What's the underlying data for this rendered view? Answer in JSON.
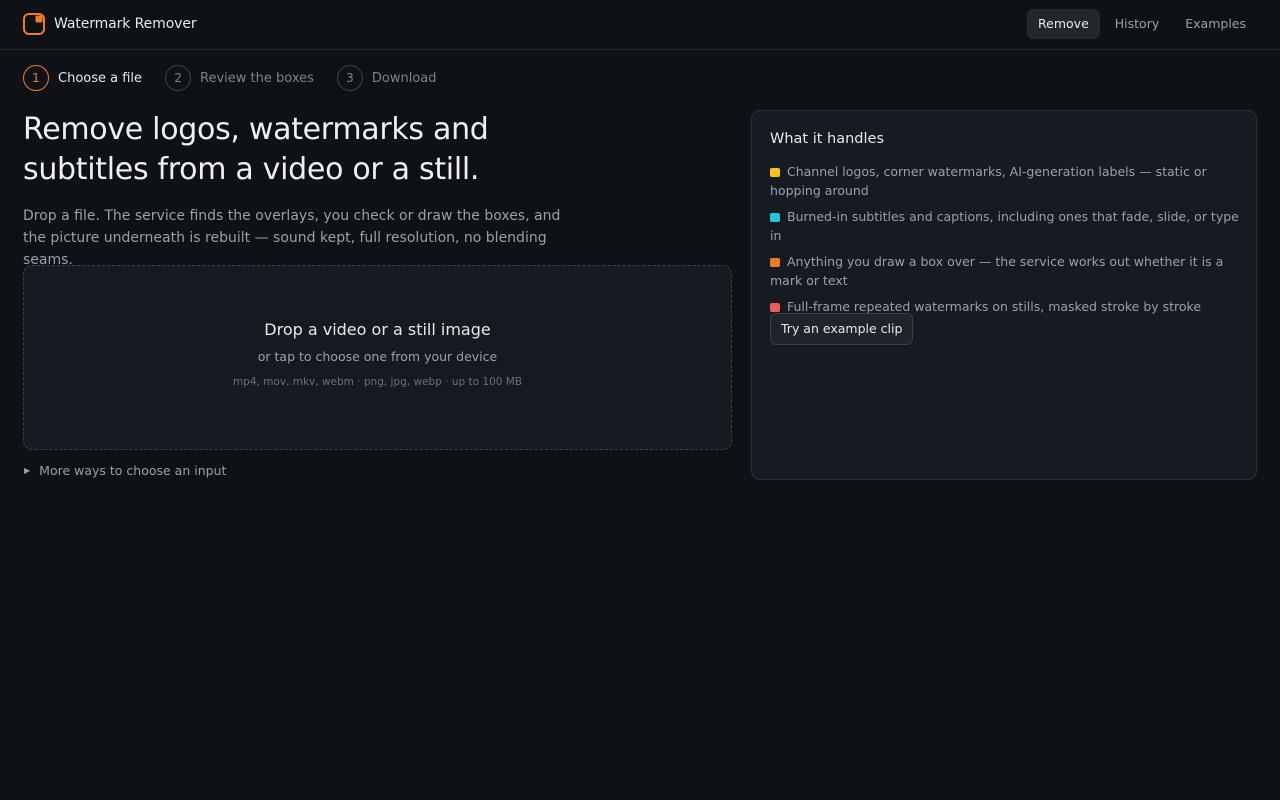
{
  "app": {
    "title": "Watermark Remover"
  },
  "nav": {
    "items": [
      {
        "label": "Remove",
        "active": true
      },
      {
        "label": "History",
        "active": false
      },
      {
        "label": "Examples",
        "active": false
      }
    ]
  },
  "steps": [
    {
      "number": "1",
      "label": "Choose a file",
      "active": true
    },
    {
      "number": "2",
      "label": "Review the boxes",
      "active": false
    },
    {
      "number": "3",
      "label": "Download",
      "active": false
    }
  ],
  "hero": {
    "headline": "Remove logos, watermarks and subtitles from a video or a still.",
    "lede": "Drop a file. The service finds the overlays, you check or draw the boxes, and the picture underneath is rebuilt — sound kept, full resolution, no blending seams."
  },
  "dropzone": {
    "title": "Drop a video or a still image",
    "subtitle": "or tap to choose one from your device",
    "formats": "mp4, mov, mkv, webm · png, jpg, webp · up to 100 MB"
  },
  "more_ways": {
    "label": "More ways to choose an input",
    "icon": "disclosure-triangle-icon"
  },
  "handles": {
    "title": "What it handles",
    "items": [
      {
        "text": "Channel logos, corner watermarks, AI-generation labels — static or hopping around",
        "color": "#f5c518"
      },
      {
        "text": "Burned-in subtitles and captions, including ones that fade, slide, or type in",
        "color": "#22c5dc"
      },
      {
        "text": "Anything you draw a box over — the service works out whether it is a mark or text",
        "color": "#f07a2a"
      },
      {
        "text": "Full-frame repeated watermarks on stills, masked stroke by stroke",
        "color": "#ef5b5b"
      }
    ],
    "button_label": "Try an example clip"
  },
  "colors": {
    "accent": "#f07a2a",
    "background": "#0e1116",
    "card": "#161a21"
  }
}
